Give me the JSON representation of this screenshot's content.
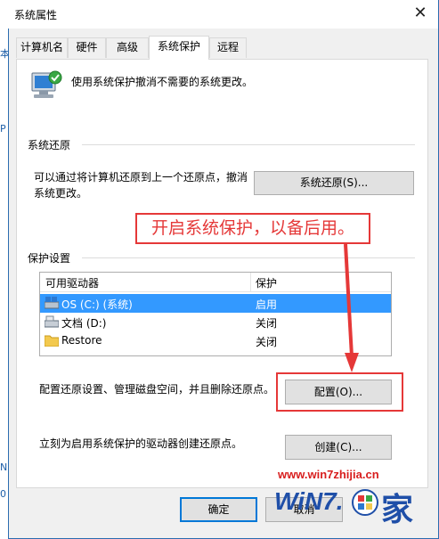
{
  "background": {
    "fragments": [
      "本",
      "P",
      "N",
      "0"
    ]
  },
  "dialog": {
    "title": "系统属性",
    "close_glyph": "✕"
  },
  "tabs": [
    {
      "label": "计算机名",
      "active": false
    },
    {
      "label": "硬件",
      "active": false
    },
    {
      "label": "高级",
      "active": false
    },
    {
      "label": "系统保护",
      "active": true
    },
    {
      "label": "远程",
      "active": false
    }
  ],
  "intro": {
    "text": "使用系统保护撤消不需要的系统更改。",
    "icon": "system-protection-icon"
  },
  "restore": {
    "group_label": "系统还原",
    "desc_line1": "可以通过将计算机还原到上一个还原点，撤消",
    "desc_line2": "系统更改。",
    "button_label": "系统还原(S)..."
  },
  "annotation": {
    "callout_text": "开启系统保护，以备后用。",
    "color": "#e53838"
  },
  "protection": {
    "group_label": "保护设置",
    "columns": [
      "可用驱动器",
      "保护"
    ],
    "rows": [
      {
        "drive": "OS (C:) (系统)",
        "status": "启用",
        "selected": true,
        "icon": "system-drive-icon"
      },
      {
        "drive": "文档 (D:)",
        "status": "关闭",
        "selected": false,
        "icon": "drive-icon"
      },
      {
        "drive": "Restore",
        "status": "关闭",
        "selected": false,
        "icon": "folder-icon"
      }
    ]
  },
  "configure": {
    "text": "配置还原设置、管理磁盘空间，并且删除还原点。",
    "button_label": "配置(O)..."
  },
  "create": {
    "text": "立刻为启用系统保护的驱动器创建还原点。",
    "button_label": "创建(C)..."
  },
  "footer": {
    "ok_label": "确定",
    "cancel_label": "取消"
  },
  "watermark": {
    "url": "www.win7zhijia.cn",
    "logo_text": "WiN7.",
    "logo_char": "家"
  }
}
